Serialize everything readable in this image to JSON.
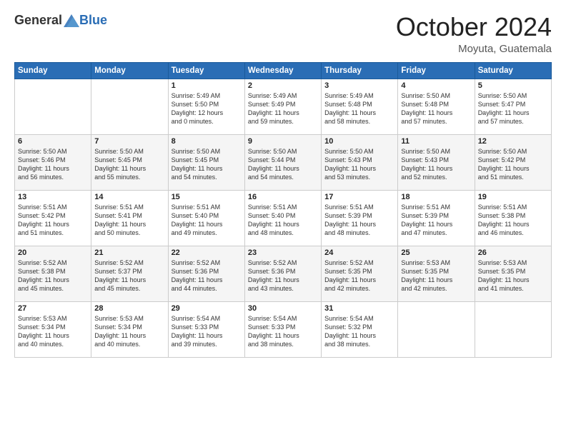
{
  "logo": {
    "general": "General",
    "blue": "Blue"
  },
  "header": {
    "month": "October 2024",
    "location": "Moyuta, Guatemala"
  },
  "weekdays": [
    "Sunday",
    "Monday",
    "Tuesday",
    "Wednesday",
    "Thursday",
    "Friday",
    "Saturday"
  ],
  "weeks": [
    [
      {
        "day": "",
        "lines": []
      },
      {
        "day": "",
        "lines": []
      },
      {
        "day": "1",
        "lines": [
          "Sunrise: 5:49 AM",
          "Sunset: 5:50 PM",
          "Daylight: 12 hours",
          "and 0 minutes."
        ]
      },
      {
        "day": "2",
        "lines": [
          "Sunrise: 5:49 AM",
          "Sunset: 5:49 PM",
          "Daylight: 11 hours",
          "and 59 minutes."
        ]
      },
      {
        "day": "3",
        "lines": [
          "Sunrise: 5:49 AM",
          "Sunset: 5:48 PM",
          "Daylight: 11 hours",
          "and 58 minutes."
        ]
      },
      {
        "day": "4",
        "lines": [
          "Sunrise: 5:50 AM",
          "Sunset: 5:48 PM",
          "Daylight: 11 hours",
          "and 57 minutes."
        ]
      },
      {
        "day": "5",
        "lines": [
          "Sunrise: 5:50 AM",
          "Sunset: 5:47 PM",
          "Daylight: 11 hours",
          "and 57 minutes."
        ]
      }
    ],
    [
      {
        "day": "6",
        "lines": [
          "Sunrise: 5:50 AM",
          "Sunset: 5:46 PM",
          "Daylight: 11 hours",
          "and 56 minutes."
        ]
      },
      {
        "day": "7",
        "lines": [
          "Sunrise: 5:50 AM",
          "Sunset: 5:45 PM",
          "Daylight: 11 hours",
          "and 55 minutes."
        ]
      },
      {
        "day": "8",
        "lines": [
          "Sunrise: 5:50 AM",
          "Sunset: 5:45 PM",
          "Daylight: 11 hours",
          "and 54 minutes."
        ]
      },
      {
        "day": "9",
        "lines": [
          "Sunrise: 5:50 AM",
          "Sunset: 5:44 PM",
          "Daylight: 11 hours",
          "and 54 minutes."
        ]
      },
      {
        "day": "10",
        "lines": [
          "Sunrise: 5:50 AM",
          "Sunset: 5:43 PM",
          "Daylight: 11 hours",
          "and 53 minutes."
        ]
      },
      {
        "day": "11",
        "lines": [
          "Sunrise: 5:50 AM",
          "Sunset: 5:43 PM",
          "Daylight: 11 hours",
          "and 52 minutes."
        ]
      },
      {
        "day": "12",
        "lines": [
          "Sunrise: 5:50 AM",
          "Sunset: 5:42 PM",
          "Daylight: 11 hours",
          "and 51 minutes."
        ]
      }
    ],
    [
      {
        "day": "13",
        "lines": [
          "Sunrise: 5:51 AM",
          "Sunset: 5:42 PM",
          "Daylight: 11 hours",
          "and 51 minutes."
        ]
      },
      {
        "day": "14",
        "lines": [
          "Sunrise: 5:51 AM",
          "Sunset: 5:41 PM",
          "Daylight: 11 hours",
          "and 50 minutes."
        ]
      },
      {
        "day": "15",
        "lines": [
          "Sunrise: 5:51 AM",
          "Sunset: 5:40 PM",
          "Daylight: 11 hours",
          "and 49 minutes."
        ]
      },
      {
        "day": "16",
        "lines": [
          "Sunrise: 5:51 AM",
          "Sunset: 5:40 PM",
          "Daylight: 11 hours",
          "and 48 minutes."
        ]
      },
      {
        "day": "17",
        "lines": [
          "Sunrise: 5:51 AM",
          "Sunset: 5:39 PM",
          "Daylight: 11 hours",
          "and 48 minutes."
        ]
      },
      {
        "day": "18",
        "lines": [
          "Sunrise: 5:51 AM",
          "Sunset: 5:39 PM",
          "Daylight: 11 hours",
          "and 47 minutes."
        ]
      },
      {
        "day": "19",
        "lines": [
          "Sunrise: 5:51 AM",
          "Sunset: 5:38 PM",
          "Daylight: 11 hours",
          "and 46 minutes."
        ]
      }
    ],
    [
      {
        "day": "20",
        "lines": [
          "Sunrise: 5:52 AM",
          "Sunset: 5:38 PM",
          "Daylight: 11 hours",
          "and 45 minutes."
        ]
      },
      {
        "day": "21",
        "lines": [
          "Sunrise: 5:52 AM",
          "Sunset: 5:37 PM",
          "Daylight: 11 hours",
          "and 45 minutes."
        ]
      },
      {
        "day": "22",
        "lines": [
          "Sunrise: 5:52 AM",
          "Sunset: 5:36 PM",
          "Daylight: 11 hours",
          "and 44 minutes."
        ]
      },
      {
        "day": "23",
        "lines": [
          "Sunrise: 5:52 AM",
          "Sunset: 5:36 PM",
          "Daylight: 11 hours",
          "and 43 minutes."
        ]
      },
      {
        "day": "24",
        "lines": [
          "Sunrise: 5:52 AM",
          "Sunset: 5:35 PM",
          "Daylight: 11 hours",
          "and 42 minutes."
        ]
      },
      {
        "day": "25",
        "lines": [
          "Sunrise: 5:53 AM",
          "Sunset: 5:35 PM",
          "Daylight: 11 hours",
          "and 42 minutes."
        ]
      },
      {
        "day": "26",
        "lines": [
          "Sunrise: 5:53 AM",
          "Sunset: 5:35 PM",
          "Daylight: 11 hours",
          "and 41 minutes."
        ]
      }
    ],
    [
      {
        "day": "27",
        "lines": [
          "Sunrise: 5:53 AM",
          "Sunset: 5:34 PM",
          "Daylight: 11 hours",
          "and 40 minutes."
        ]
      },
      {
        "day": "28",
        "lines": [
          "Sunrise: 5:53 AM",
          "Sunset: 5:34 PM",
          "Daylight: 11 hours",
          "and 40 minutes."
        ]
      },
      {
        "day": "29",
        "lines": [
          "Sunrise: 5:54 AM",
          "Sunset: 5:33 PM",
          "Daylight: 11 hours",
          "and 39 minutes."
        ]
      },
      {
        "day": "30",
        "lines": [
          "Sunrise: 5:54 AM",
          "Sunset: 5:33 PM",
          "Daylight: 11 hours",
          "and 38 minutes."
        ]
      },
      {
        "day": "31",
        "lines": [
          "Sunrise: 5:54 AM",
          "Sunset: 5:32 PM",
          "Daylight: 11 hours",
          "and 38 minutes."
        ]
      },
      {
        "day": "",
        "lines": []
      },
      {
        "day": "",
        "lines": []
      }
    ]
  ]
}
